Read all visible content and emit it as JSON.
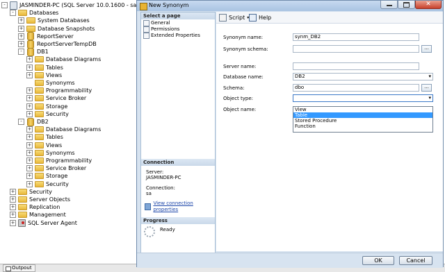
{
  "object_explorer": {
    "nodes": [
      {
        "label": "JASMINDER-PC (SQL Server 10.0.1600 - sa)",
        "indent": 0,
        "expander": "-",
        "icon": "server-icon"
      },
      {
        "label": "Databases",
        "indent": 1,
        "expander": "-",
        "icon": "folder-icon"
      },
      {
        "label": "System Databases",
        "indent": 2,
        "expander": "+",
        "icon": "folder-icon"
      },
      {
        "label": "Database Snapshots",
        "indent": 2,
        "expander": "+",
        "icon": "folder-icon"
      },
      {
        "label": "ReportServer",
        "indent": 2,
        "expander": "+",
        "icon": "database-icon"
      },
      {
        "label": "ReportServerTempDB",
        "indent": 2,
        "expander": "+",
        "icon": "database-icon"
      },
      {
        "label": "DB1",
        "indent": 2,
        "expander": "-",
        "icon": "database-icon"
      },
      {
        "label": "Database Diagrams",
        "indent": 3,
        "expander": "+",
        "icon": "folder-icon"
      },
      {
        "label": "Tables",
        "indent": 3,
        "expander": "+",
        "icon": "folder-icon"
      },
      {
        "label": "Views",
        "indent": 3,
        "expander": "+",
        "icon": "folder-icon"
      },
      {
        "label": "Synonyms",
        "indent": 3,
        "expander": "",
        "icon": "folder-icon"
      },
      {
        "label": "Programmability",
        "indent": 3,
        "expander": "+",
        "icon": "folder-icon"
      },
      {
        "label": "Service Broker",
        "indent": 3,
        "expander": "+",
        "icon": "folder-icon"
      },
      {
        "label": "Storage",
        "indent": 3,
        "expander": "+",
        "icon": "folder-icon"
      },
      {
        "label": "Security",
        "indent": 3,
        "expander": "+",
        "icon": "folder-icon"
      },
      {
        "label": "DB2",
        "indent": 2,
        "expander": "-",
        "icon": "database-icon"
      },
      {
        "label": "Database Diagrams",
        "indent": 3,
        "expander": "+",
        "icon": "folder-icon"
      },
      {
        "label": "Tables",
        "indent": 3,
        "expander": "+",
        "icon": "folder-icon"
      },
      {
        "label": "Views",
        "indent": 3,
        "expander": "+",
        "icon": "folder-icon"
      },
      {
        "label": "Synonyms",
        "indent": 3,
        "expander": "+",
        "icon": "folder-icon"
      },
      {
        "label": "Programmability",
        "indent": 3,
        "expander": "+",
        "icon": "folder-icon"
      },
      {
        "label": "Service Broker",
        "indent": 3,
        "expander": "+",
        "icon": "folder-icon"
      },
      {
        "label": "Storage",
        "indent": 3,
        "expander": "+",
        "icon": "folder-icon"
      },
      {
        "label": "Security",
        "indent": 3,
        "expander": "+",
        "icon": "folder-icon"
      },
      {
        "label": "Security",
        "indent": 1,
        "expander": "+",
        "icon": "folder-icon"
      },
      {
        "label": "Server Objects",
        "indent": 1,
        "expander": "+",
        "icon": "folder-icon"
      },
      {
        "label": "Replication",
        "indent": 1,
        "expander": "+",
        "icon": "folder-icon"
      },
      {
        "label": "Management",
        "indent": 1,
        "expander": "+",
        "icon": "folder-icon"
      },
      {
        "label": "SQL Server Agent",
        "indent": 1,
        "expander": "+",
        "icon": "agent-icon"
      }
    ]
  },
  "output_tab": "Outpout",
  "dialog": {
    "title": "New Synonym",
    "select_page_header": "Select a page",
    "pages": [
      "General",
      "Permissions",
      "Extended Properties"
    ],
    "connection": {
      "header": "Connection",
      "server_label": "Server:",
      "server_value": "JASMINDER-PC",
      "connection_label": "Connection:",
      "connection_value": "sa",
      "link": "View connection properties"
    },
    "progress": {
      "header": "Progress",
      "status": "Ready"
    },
    "toolbar": {
      "script": "Script",
      "help": "Help"
    },
    "form": {
      "synonym_name_label": "Synonym name:",
      "synonym_name_value": "synm_DB2",
      "synonym_schema_label": "Synonym schema:",
      "synonym_schema_value": "",
      "server_name_label": "Server name:",
      "server_name_value": "",
      "database_name_label": "Database name:",
      "database_name_value": "DB2",
      "schema_label": "Schema:",
      "schema_value": "dbo",
      "object_type_label": "Object type:",
      "object_type_value": "",
      "object_name_label": "Object name:",
      "browse": "..."
    },
    "object_type_options": [
      "View",
      "Table",
      "Stored Procedure",
      "Function"
    ],
    "object_type_highlighted": "Table",
    "buttons": {
      "ok": "OK",
      "cancel": "Cancel"
    }
  }
}
